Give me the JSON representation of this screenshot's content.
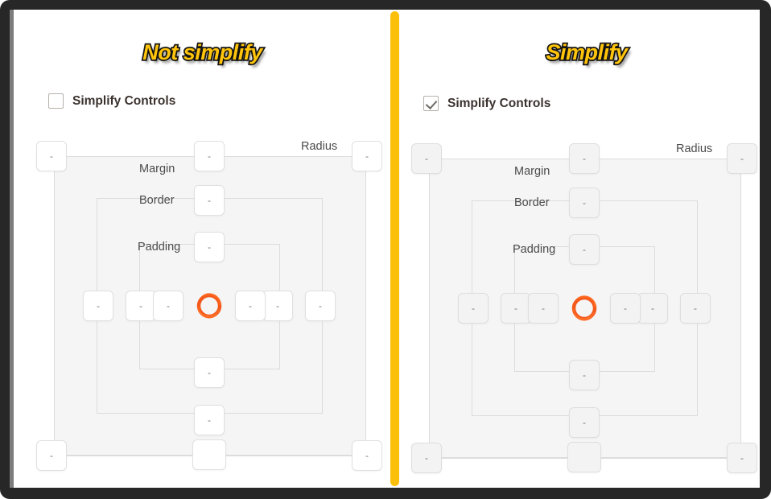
{
  "window": {
    "frame_color": "#272727",
    "background": "#ffffff"
  },
  "divider": {
    "name": "vertical-divider",
    "color": "#fcc00b"
  },
  "panels": [
    {
      "id": "left",
      "banner": "Not simplify",
      "checkbox": {
        "label": "Simplify Controls",
        "checked": false
      },
      "boxmodel": {
        "labels": {
          "margin": "Margin",
          "border": "Border",
          "padding": "Padding",
          "radius": "Radius"
        },
        "fields": {
          "radius_top_left": "-",
          "radius_top_right": "-",
          "radius_bottom_left": "-",
          "radius_bottom_right": "-",
          "margin_top": "-",
          "margin_left": "-",
          "margin_right": "-",
          "margin_bottom": "",
          "border_top": "-",
          "border_left": "-",
          "border_right": "-",
          "border_bottom": "-",
          "padding_top": "-",
          "padding_left": "-",
          "padding_right": "-",
          "padding_bottom": "-"
        },
        "logo": "orange-ring-logo"
      }
    },
    {
      "id": "right",
      "banner": "Simplify",
      "checkbox": {
        "label": "Simplify Controls",
        "checked": true
      },
      "boxmodel": {
        "labels": {
          "margin": "Margin",
          "border": "Border",
          "padding": "Padding",
          "radius": "Radius"
        },
        "fields": {
          "radius_top_left": "-",
          "radius_top_right": "-",
          "radius_bottom_left": "-",
          "radius_bottom_right": "-",
          "margin_top": "-",
          "margin_left": "-",
          "margin_right": "-",
          "margin_bottom": "",
          "border_top": "-",
          "border_left": "-",
          "border_right": "-",
          "border_bottom": "-",
          "padding_top": "-",
          "padding_left": "-",
          "padding_right": "-",
          "padding_bottom": "-"
        },
        "logo": "orange-ring-logo"
      }
    }
  ],
  "colors": {
    "banner_fill": "#ffc40b",
    "banner_stroke": "#171717",
    "divider": "#fcc00b",
    "logo_orange": "#f4581a",
    "boxmodel_fill": "#f5f5f5",
    "boxmodel_line": "#dcdcdc"
  }
}
